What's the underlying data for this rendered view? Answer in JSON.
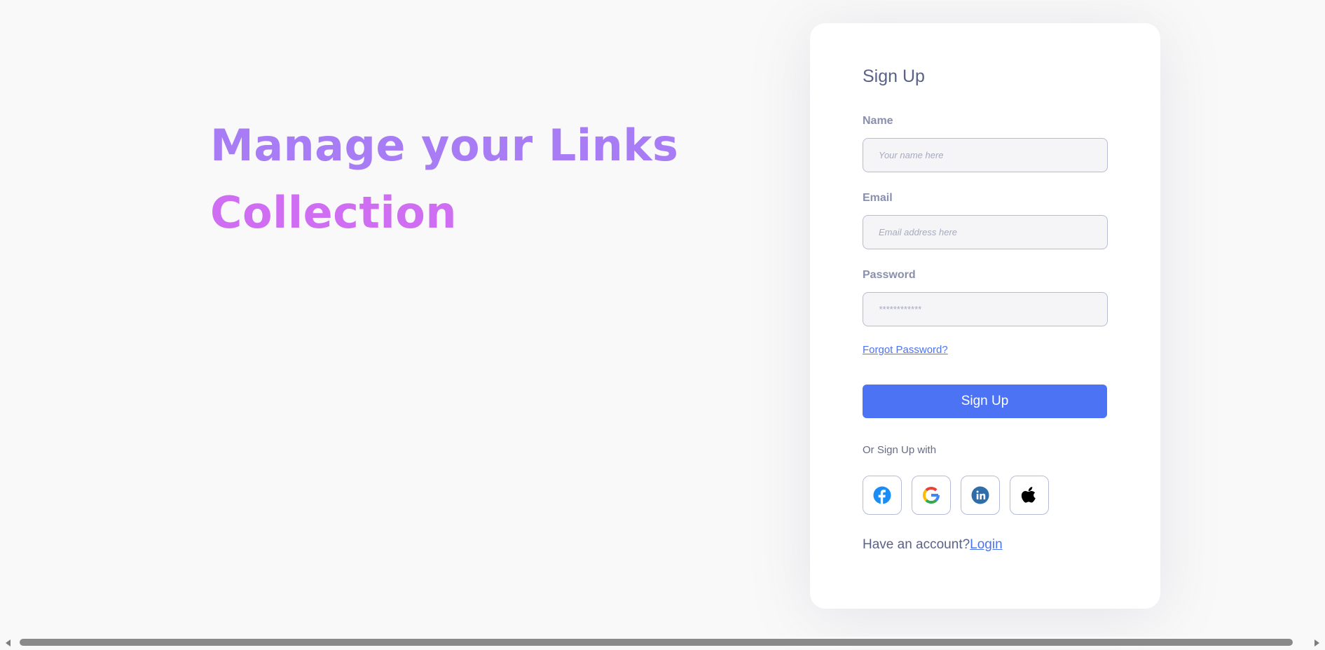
{
  "hero": {
    "line1": "Manage your Links",
    "line2": "Collection"
  },
  "form": {
    "title": "Sign Up",
    "name_label": "Name",
    "name_placeholder": "Your name here",
    "email_label": "Email",
    "email_placeholder": "Email address here",
    "password_label": "Password",
    "password_placeholder": "************",
    "forgot_password": "Forgot Password?",
    "submit_label": "Sign Up",
    "social_label": "Or Sign Up with",
    "social_icons": [
      "facebook-icon",
      "google-icon",
      "linkedin-icon",
      "apple-icon"
    ],
    "account_text": "Have an account?",
    "login_link": "Login"
  },
  "colors": {
    "accent": "#4d73f5",
    "hero_line1": "#a77cf5",
    "hero_line2": "#cf6ef2",
    "label": "#8a8fac"
  }
}
